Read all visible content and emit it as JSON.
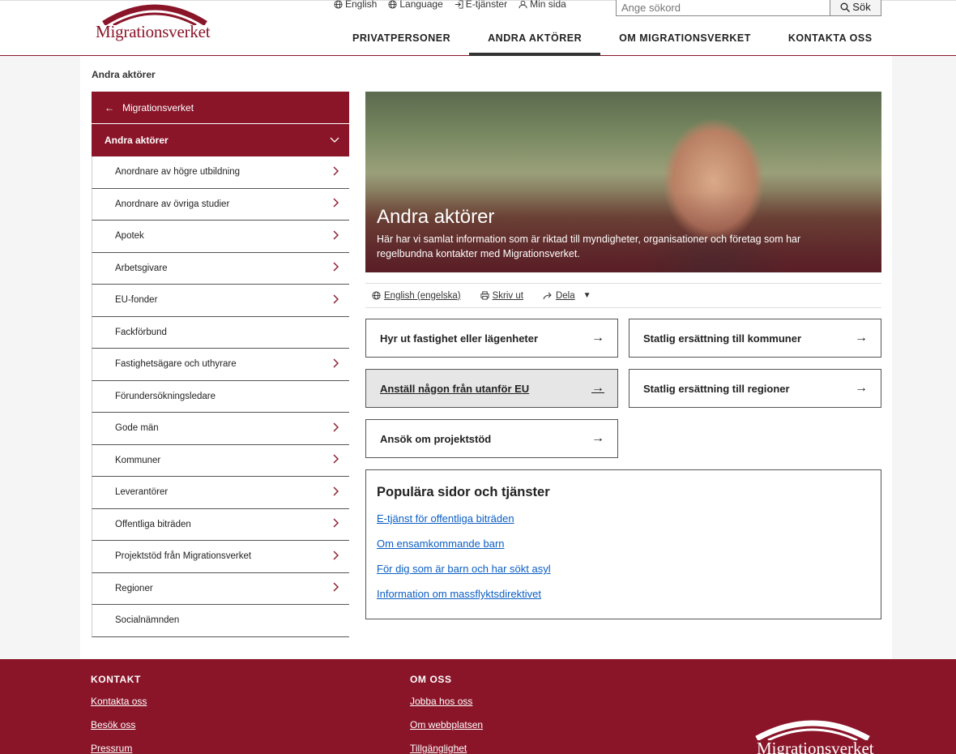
{
  "brand": {
    "logo_text": "Migrationsverket",
    "primary_color": "#8a1529"
  },
  "header": {
    "toplinks": [
      {
        "label": "English",
        "icon": "globe-icon"
      },
      {
        "label": "Language",
        "icon": "globe-icon"
      },
      {
        "label": "E-tjänster",
        "icon": "login-icon"
      },
      {
        "label": "Min sida",
        "icon": "user-icon"
      }
    ],
    "search": {
      "placeholder": "Ange sökord",
      "button_label": "Sök"
    },
    "nav": [
      {
        "label": "PRIVATPERSONER",
        "active": false
      },
      {
        "label": "ANDRA AKTÖRER",
        "active": true
      },
      {
        "label": "OM MIGRATIONSVERKET",
        "active": false
      },
      {
        "label": "KONTAKTA OSS",
        "active": false
      }
    ]
  },
  "breadcrumb": "Andra aktörer",
  "sidenav": {
    "back_label": "Migrationsverket",
    "current_label": "Andra aktörer",
    "items": [
      {
        "label": "Anordnare av högre utbildning",
        "has_children": true
      },
      {
        "label": "Anordnare av övriga studier",
        "has_children": true
      },
      {
        "label": "Apotek",
        "has_children": true
      },
      {
        "label": "Arbetsgivare",
        "has_children": true
      },
      {
        "label": "EU-fonder",
        "has_children": true
      },
      {
        "label": "Fackförbund",
        "has_children": false
      },
      {
        "label": "Fastighetsägare och uthyrare",
        "has_children": true
      },
      {
        "label": "Förundersökningsledare",
        "has_children": false
      },
      {
        "label": "Gode män",
        "has_children": true
      },
      {
        "label": "Kommuner",
        "has_children": true
      },
      {
        "label": "Leverantörer",
        "has_children": true
      },
      {
        "label": "Offentliga biträden",
        "has_children": true
      },
      {
        "label": "Projektstöd från Migrationsverket",
        "has_children": true
      },
      {
        "label": "Regioner",
        "has_children": true
      },
      {
        "label": "Socialnämnden",
        "has_children": false
      }
    ]
  },
  "hero": {
    "title": "Andra aktörer",
    "text": "Här har vi samlat information som är riktad till myndigheter, organisationer och företag som har regelbundna kontakter med Migrationsverket."
  },
  "tools": {
    "english": "English (engelska)",
    "print": "Skriv ut",
    "share": "Dela"
  },
  "cards": [
    {
      "label": "Hyr ut fastighet eller lägenheter"
    },
    {
      "label": "Statlig ersättning till kommuner"
    },
    {
      "label": "Anställ någon från utanför EU"
    },
    {
      "label": "Statlig ersättning till regioner"
    },
    {
      "label": "Ansök om projektstöd"
    }
  ],
  "popular": {
    "title": "Populära sidor och tjänster",
    "links": [
      "E-tjänst för offentliga biträden",
      "Om ensamkommande barn",
      "För dig som är barn och har sökt asyl",
      "Information om massflyktsdirektivet"
    ]
  },
  "footer": {
    "kontakt": {
      "title": "KONTAKT",
      "links": [
        "Kontakta oss",
        "Besök oss",
        "Pressrum"
      ]
    },
    "omoss": {
      "title": "OM OSS",
      "links": [
        "Jobba hos oss",
        "Om webbplatsen",
        "Tillgänglighet"
      ]
    }
  }
}
